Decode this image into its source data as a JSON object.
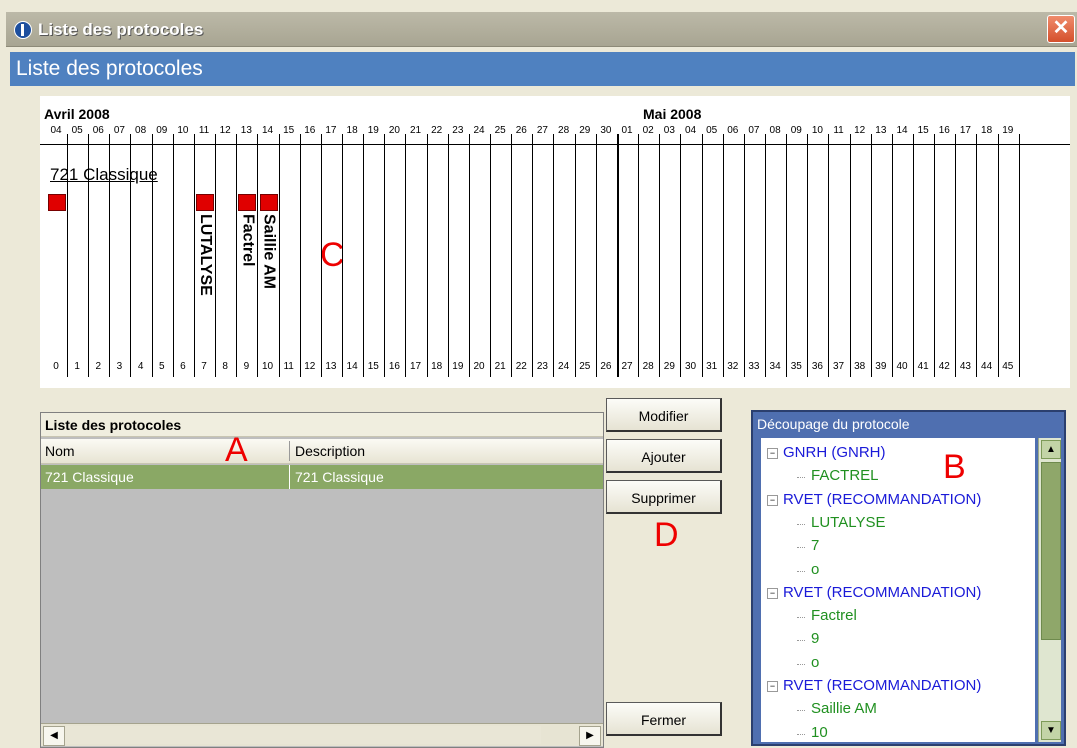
{
  "window": {
    "title": "Liste des protocoles",
    "close_symbol": "✕"
  },
  "header": {
    "title": "Liste des protocoles"
  },
  "timeline": {
    "months": [
      {
        "label": "Avril 2008"
      },
      {
        "label": "Mai 2008"
      }
    ],
    "april_days": [
      "04",
      "05",
      "06",
      "07",
      "08",
      "09",
      "10",
      "11",
      "12",
      "13",
      "14",
      "15",
      "16",
      "17",
      "18",
      "19",
      "20",
      "21",
      "22",
      "23",
      "24",
      "25",
      "26",
      "27",
      "28",
      "29",
      "30"
    ],
    "may_days": [
      "01",
      "02",
      "03",
      "04",
      "05",
      "06",
      "07",
      "08",
      "09",
      "10",
      "11",
      "12",
      "13",
      "14",
      "15",
      "16",
      "17",
      "18",
      "19"
    ],
    "protocol_name": "721 Classique",
    "events": [
      {
        "label": "",
        "color": "#e00000"
      },
      {
        "label": "LUTALYSE",
        "color": "#e00000"
      },
      {
        "label": "Factrel",
        "color": "#e00000"
      },
      {
        "label": "Saillie AM",
        "color": "#e00000"
      }
    ],
    "annotation": "C"
  },
  "list": {
    "title": "Liste des protocoles",
    "columns": [
      "Nom",
      "Description"
    ],
    "rows": [
      {
        "name": "721 Classique",
        "description": "721 Classique"
      }
    ],
    "annotation": "A"
  },
  "buttons": {
    "modify": "Modifier",
    "add": "Ajouter",
    "delete": "Supprimer",
    "close": "Fermer",
    "annotation": "D"
  },
  "tree": {
    "title": "Découpage du protocole",
    "annotation": "B",
    "nodes": [
      {
        "label": "GNRH  (GNRH)",
        "level": 0
      },
      {
        "label": "FACTREL",
        "level": 1
      },
      {
        "label": "RVET  (RECOMMANDATION)",
        "level": 0
      },
      {
        "label": "LUTALYSE",
        "level": 1
      },
      {
        "label": "7",
        "level": 1
      },
      {
        "label": "o",
        "level": 1
      },
      {
        "label": "RVET  (RECOMMANDATION)",
        "level": 0
      },
      {
        "label": "Factrel",
        "level": 1
      },
      {
        "label": "9",
        "level": 1
      },
      {
        "label": "o",
        "level": 1
      },
      {
        "label": "RVET  (RECOMMANDATION)",
        "level": 0
      },
      {
        "label": "Saillie AM",
        "level": 1
      },
      {
        "label": "10",
        "level": 1
      }
    ]
  },
  "colors": {
    "header_blue": "#4f81c0",
    "selected_row": "#8aa865",
    "tree_parent": "#1a1ad8",
    "tree_child": "#209020",
    "annotation_red": "#e00000"
  }
}
